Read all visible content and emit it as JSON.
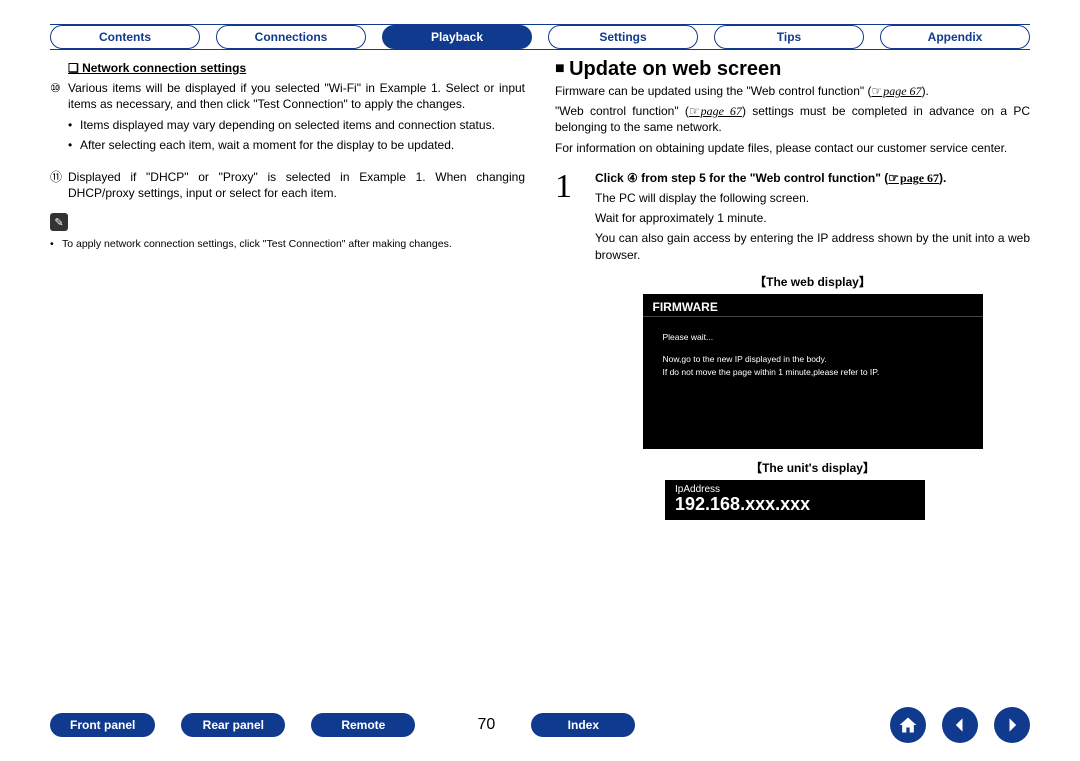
{
  "tabs": {
    "contents": "Contents",
    "connections": "Connections",
    "playback": "Playback",
    "settings": "Settings",
    "tips": "Tips",
    "appendix": "Appendix"
  },
  "left": {
    "heading": "Network connection settings",
    "item10": "Various items will be displayed if you selected \"Wi-Fi\" in Example 1. Select or input items as necessary, and then click \"Test Connection\" to apply the changes.",
    "b1": "Items displayed may vary depending on selected items and connection status.",
    "b2": "After selecting each item, wait a moment for the display to be updated.",
    "item11": "Displayed if \"DHCP\" or \"Proxy\" is selected in Example 1. When changing DHCP/proxy settings, input or select for each item.",
    "note": "To apply network connection settings, click \"Test Connection\" after making changes."
  },
  "right": {
    "heading": "Update on web screen",
    "p1a": "Firmware can be updated using the \"Web control function\" (",
    "p1_ref": "page 67",
    "p1b": ").",
    "p2a": "\"Web control function\" (",
    "p2_ref": "page 67",
    "p2b": ") settings must be completed in advance on a PC belonging to the same network.",
    "p3": "For information on obtaining update files, please contact our customer service center.",
    "step1_num": "1",
    "step1_b_a": "Click ④ from step 5 for the \"Web control function\" (",
    "step1_b_ref": "page 67",
    "step1_b_b": ").",
    "step1_l1": "The PC will display the following screen.",
    "step1_l2": "Wait for approximately 1 minute.",
    "step1_l3": "You can also gain access by entering the IP address shown by the unit into a web browser.",
    "web_caption": "【The web display】",
    "web_hdr": "FIRMWARE",
    "web_l1": "Please wait...",
    "web_l2": "Now,go to the new IP displayed in the body.",
    "web_l3": "If do not move the page within 1 minute,please refer to IP.",
    "unit_caption": "【The unit's display】",
    "unit_lbl": "IpAddress",
    "unit_ip": "192.168.xxx.xxx"
  },
  "bottom": {
    "front": "Front panel",
    "rear": "Rear panel",
    "remote": "Remote",
    "index": "Index",
    "page": "70"
  },
  "markers": {
    "m10": "⑩",
    "m11": "⑪",
    "dot": "•"
  }
}
